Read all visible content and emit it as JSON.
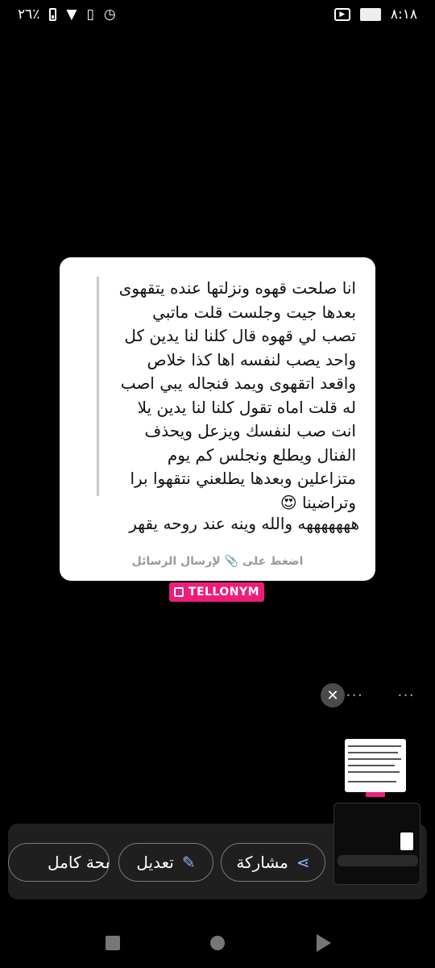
{
  "status_bar": {
    "time": "٨:١٨",
    "battery_percent": "٢٦٪",
    "icons_left": [
      "battery-icon",
      "wifi-icon",
      "vibrate-icon",
      "alarm-icon"
    ],
    "icons_right": [
      "notification-app-icon",
      "notification-image-icon"
    ]
  },
  "message_card": {
    "quote": "انا صلحت قهوه ونزلتها عنده يتقهوى\nبعدها جيت وجلست قلت ماتبي\nتصب لي قهوه قال كلنا لنا يدين كل\nواحد يصب لنفسه اها كذا خلاص\nواقعد اتقهوى ويمد فنجاله يبي اصب\nله قلت اماه تقول كلنا لنا يدين يلا\nانت صب لنفسك ويزعل ويحذف\nالفنال ويطلع ونجلس كم يوم\nمتزاعلين وبعدها يطلعني نتقهوا برا\nوتراضينا 😍",
    "reply": "هههههههه والله وينه عند روحه يقهر",
    "tap_hint": "اضغط على 📎 لإرسال الرسائل"
  },
  "brand": {
    "label": "TELLONYM",
    "color": "#ee1e78"
  },
  "screenshot_preview": {
    "close_label": "✕"
  },
  "actions": {
    "share_label": "مشاركة",
    "edit_label": "تعديل",
    "full_page_label": "صفحة كامل"
  },
  "colors": {
    "background": "#000000",
    "panel": "#1f1f1f",
    "accent_icon": "#8fb4ff"
  }
}
